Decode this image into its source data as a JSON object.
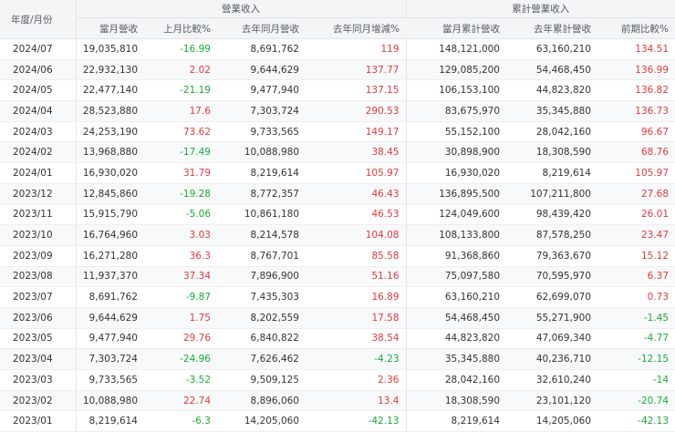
{
  "header": {
    "period_label": "年度/月份",
    "group_monthly": "營業收入",
    "group_cumulative": "累計營業收入",
    "col_monthly": "當月營收",
    "col_mom": "上月比較%",
    "col_ly_monthly": "去年同月營收",
    "col_yoy": "去年同月增減%",
    "col_cum": "當月累計營收",
    "col_ly_cum": "去年累計營收",
    "col_cum_change": "前期比較%"
  },
  "colors": {
    "positive": "#e4393c",
    "negative": "#1aaa37",
    "header_bg": "#f4f5f7"
  },
  "rows": [
    {
      "period": "2024/07",
      "monthly": "19,035,810",
      "mom": "-16.99",
      "ly_monthly": "8,691,762",
      "yoy": "119",
      "cum": "148,121,000",
      "ly_cum": "63,160,210",
      "cum_change": "134.51"
    },
    {
      "period": "2024/06",
      "monthly": "22,932,130",
      "mom": "2.02",
      "ly_monthly": "9,644,629",
      "yoy": "137.77",
      "cum": "129,085,200",
      "ly_cum": "54,468,450",
      "cum_change": "136.99"
    },
    {
      "period": "2024/05",
      "monthly": "22,477,140",
      "mom": "-21.19",
      "ly_monthly": "9,477,940",
      "yoy": "137.15",
      "cum": "106,153,100",
      "ly_cum": "44,823,820",
      "cum_change": "136.82"
    },
    {
      "period": "2024/04",
      "monthly": "28,523,880",
      "mom": "17.6",
      "ly_monthly": "7,303,724",
      "yoy": "290.53",
      "cum": "83,675,970",
      "ly_cum": "35,345,880",
      "cum_change": "136.73"
    },
    {
      "period": "2024/03",
      "monthly": "24,253,190",
      "mom": "73.62",
      "ly_monthly": "9,733,565",
      "yoy": "149.17",
      "cum": "55,152,100",
      "ly_cum": "28,042,160",
      "cum_change": "96.67"
    },
    {
      "period": "2024/02",
      "monthly": "13,968,880",
      "mom": "-17.49",
      "ly_monthly": "10,088,980",
      "yoy": "38.45",
      "cum": "30,898,900",
      "ly_cum": "18,308,590",
      "cum_change": "68.76"
    },
    {
      "period": "2024/01",
      "monthly": "16,930,020",
      "mom": "31.79",
      "ly_monthly": "8,219,614",
      "yoy": "105.97",
      "cum": "16,930,020",
      "ly_cum": "8,219,614",
      "cum_change": "105.97"
    },
    {
      "period": "2023/12",
      "monthly": "12,845,860",
      "mom": "-19.28",
      "ly_monthly": "8,772,357",
      "yoy": "46.43",
      "cum": "136,895,500",
      "ly_cum": "107,211,800",
      "cum_change": "27.68"
    },
    {
      "period": "2023/11",
      "monthly": "15,915,790",
      "mom": "-5.06",
      "ly_monthly": "10,861,180",
      "yoy": "46.53",
      "cum": "124,049,600",
      "ly_cum": "98,439,420",
      "cum_change": "26.01"
    },
    {
      "period": "2023/10",
      "monthly": "16,764,960",
      "mom": "3.03",
      "ly_monthly": "8,214,578",
      "yoy": "104.08",
      "cum": "108,133,800",
      "ly_cum": "87,578,250",
      "cum_change": "23.47"
    },
    {
      "period": "2023/09",
      "monthly": "16,271,280",
      "mom": "36.3",
      "ly_monthly": "8,767,701",
      "yoy": "85.58",
      "cum": "91,368,860",
      "ly_cum": "79,363,670",
      "cum_change": "15.12"
    },
    {
      "period": "2023/08",
      "monthly": "11,937,370",
      "mom": "37.34",
      "ly_monthly": "7,896,900",
      "yoy": "51.16",
      "cum": "75,097,580",
      "ly_cum": "70,595,970",
      "cum_change": "6.37"
    },
    {
      "period": "2023/07",
      "monthly": "8,691,762",
      "mom": "-9.87",
      "ly_monthly": "7,435,303",
      "yoy": "16.89",
      "cum": "63,160,210",
      "ly_cum": "62,699,070",
      "cum_change": "0.73"
    },
    {
      "period": "2023/06",
      "monthly": "9,644,629",
      "mom": "1.75",
      "ly_monthly": "8,202,559",
      "yoy": "17.58",
      "cum": "54,468,450",
      "ly_cum": "55,271,900",
      "cum_change": "-1.45"
    },
    {
      "period": "2023/05",
      "monthly": "9,477,940",
      "mom": "29.76",
      "ly_monthly": "6,840,822",
      "yoy": "38.54",
      "cum": "44,823,820",
      "ly_cum": "47,069,340",
      "cum_change": "-4.77"
    },
    {
      "period": "2023/04",
      "monthly": "7,303,724",
      "mom": "-24.96",
      "ly_monthly": "7,626,462",
      "yoy": "-4.23",
      "cum": "35,345,880",
      "ly_cum": "40,236,710",
      "cum_change": "-12.15"
    },
    {
      "period": "2023/03",
      "monthly": "9,733,565",
      "mom": "-3.52",
      "ly_monthly": "9,509,125",
      "yoy": "2.36",
      "cum": "28,042,160",
      "ly_cum": "32,610,240",
      "cum_change": "-14"
    },
    {
      "period": "2023/02",
      "monthly": "10,088,980",
      "mom": "22.74",
      "ly_monthly": "8,896,060",
      "yoy": "13.4",
      "cum": "18,308,590",
      "ly_cum": "23,101,120",
      "cum_change": "-20.74"
    },
    {
      "period": "2023/01",
      "monthly": "8,219,614",
      "mom": "-6.3",
      "ly_monthly": "14,205,060",
      "yoy": "-42.13",
      "cum": "8,219,614",
      "ly_cum": "14,205,060",
      "cum_change": "-42.13"
    }
  ]
}
